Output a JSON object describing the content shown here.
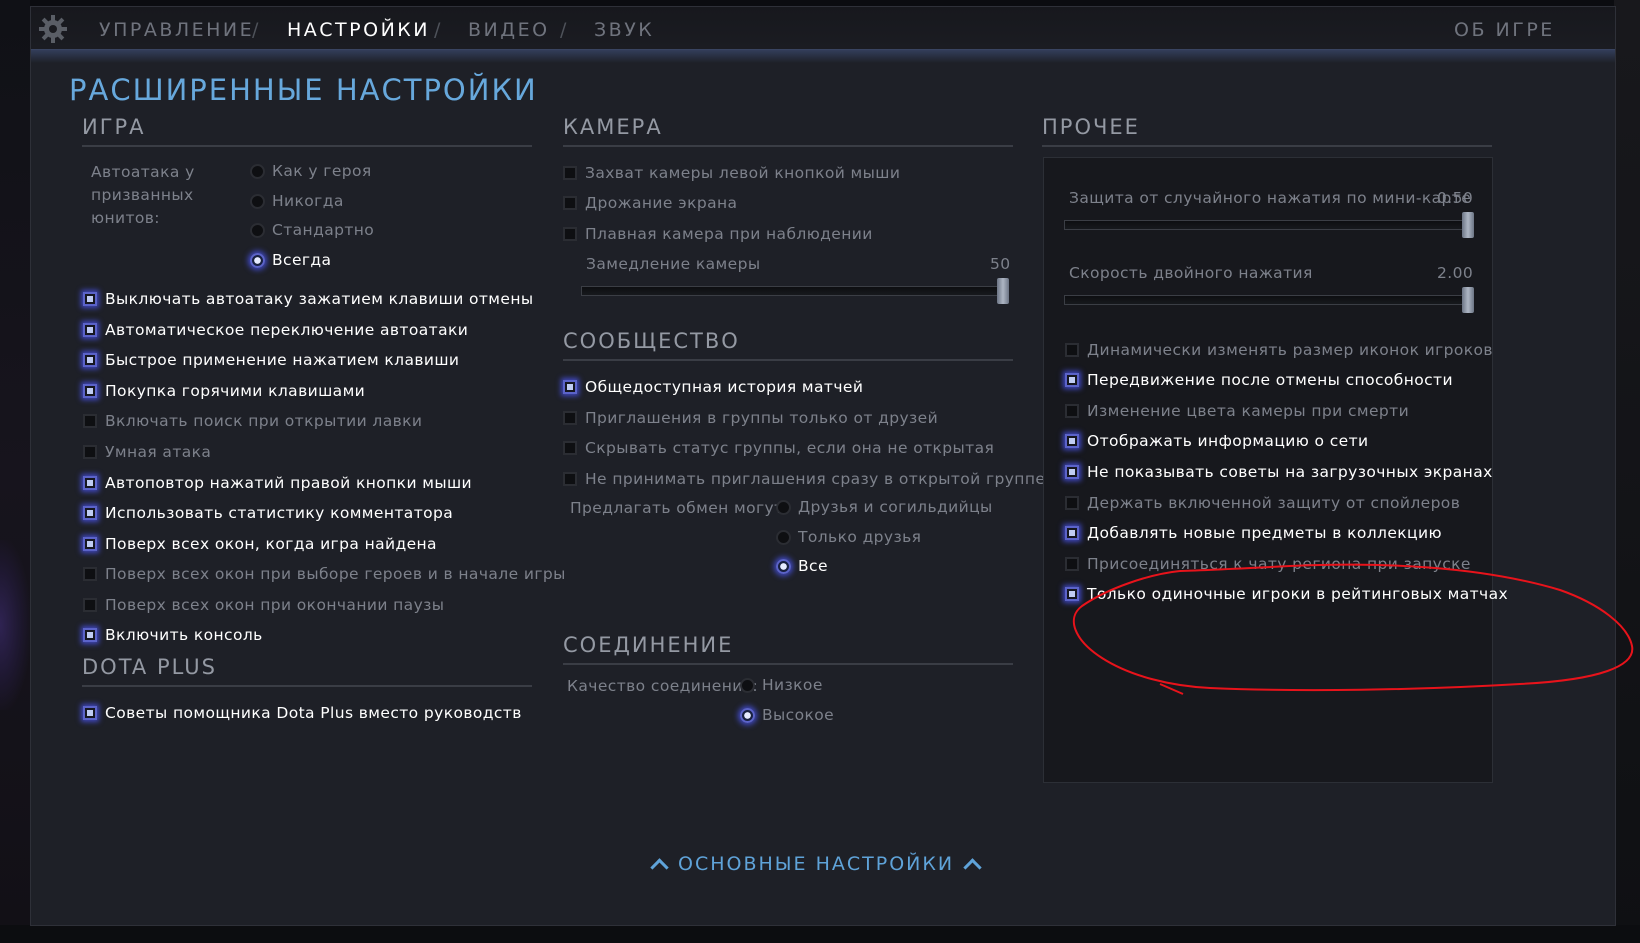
{
  "nav": {
    "tabs": [
      {
        "label": "УПРАВЛЕНИЕ"
      },
      {
        "label": "НАСТРОЙКИ"
      },
      {
        "label": "ВИДЕО"
      },
      {
        "label": "ЗВУК"
      }
    ],
    "separator": "/",
    "about": "ОБ ИГРЕ",
    "active_tab": "НАСТРОЙКИ"
  },
  "page_title": "РАСШИРЕННЫЕ НАСТРОЙКИ",
  "game": {
    "title": "ИГРА",
    "autoattack_label": [
      "Автоатака у",
      "призванных",
      "юнитов:"
    ],
    "autoattack_options": [
      {
        "label": "Как у героя",
        "selected": false
      },
      {
        "label": "Никогда",
        "selected": false
      },
      {
        "label": "Стандартно",
        "selected": false
      },
      {
        "label": "Всегда",
        "selected": true
      }
    ],
    "options": [
      {
        "label": "Выключать автоатаку зажатием клавиши отмены",
        "checked": true
      },
      {
        "label": "Автоматическое переключение автоатаки",
        "checked": true
      },
      {
        "label": "Быстрое применение нажатием клавиши",
        "checked": true
      },
      {
        "label": "Покупка горячими клавишами",
        "checked": true
      },
      {
        "label": "Включать поиск при открытии лавки",
        "checked": false
      },
      {
        "label": "Умная атака",
        "checked": false
      },
      {
        "label": "Автоповтор нажатий правой кнопки мыши",
        "checked": true
      },
      {
        "label": "Использовать статистику комментатора",
        "checked": true
      },
      {
        "label": "Поверх всех окон, когда игра найдена",
        "checked": true
      },
      {
        "label": "Поверх всех окон при выборе героев и в начале игры",
        "checked": false
      },
      {
        "label": "Поверх всех окон при окончании паузы",
        "checked": false
      },
      {
        "label": "Включить консоль",
        "checked": true
      }
    ]
  },
  "dota_plus": {
    "title": "DOTA PLUS",
    "options": [
      {
        "label": "Советы помощника Dota Plus вместо руководств",
        "checked": true
      }
    ]
  },
  "camera": {
    "title": "КАМЕРА",
    "options": [
      {
        "label": "Захват камеры левой кнопкой мыши",
        "checked": false
      },
      {
        "label": "Дрожание экрана",
        "checked": false
      },
      {
        "label": "Плавная камера при наблюдении",
        "checked": false
      }
    ],
    "slowdown_label": "Замедление камеры",
    "slowdown_value": "50",
    "slowdown_fraction": 1.0
  },
  "community": {
    "title": "СООБЩЕСТВО",
    "options": [
      {
        "label": "Общедоступная история матчей",
        "checked": true
      },
      {
        "label": "Приглашения в группы только от друзей",
        "checked": false
      },
      {
        "label": "Скрывать статус группы, если она не открытая",
        "checked": false
      },
      {
        "label": "Не принимать приглашения сразу в открытой группе",
        "checked": false
      }
    ],
    "trade_label": "Предлагать обмен могут:",
    "trade_options": [
      {
        "label": "Друзья и согильдийцы",
        "selected": false
      },
      {
        "label": "Только друзья",
        "selected": false
      },
      {
        "label": "Все",
        "selected": true
      }
    ]
  },
  "connection": {
    "title": "СОЕДИНЕНИЕ",
    "quality_label": "Качество соединения:",
    "quality_options": [
      {
        "label": "Низкое",
        "selected": false
      },
      {
        "label": "Высокое",
        "selected": true
      }
    ]
  },
  "misc": {
    "title": "ПРОЧЕЕ",
    "minimap_protect_label": "Защита от случайного нажатия по мини-карте",
    "minimap_protect_value": "0.50",
    "minimap_protect_fraction": 1.0,
    "double_tap_label": "Скорость двойного нажатия",
    "double_tap_value": "2.00",
    "double_tap_fraction": 1.0,
    "options": [
      {
        "label": "Динамически изменять размер иконок игроков",
        "checked": false
      },
      {
        "label": "Передвижение после отмены способности",
        "checked": true
      },
      {
        "label": "Изменение цвета камеры при смерти",
        "checked": false
      },
      {
        "label": "Отображать информацию о сети",
        "checked": true
      },
      {
        "label": "Не показывать советы на загрузочных экранах",
        "checked": true
      },
      {
        "label": "Держать включенной защиту от спойлеров",
        "checked": false
      },
      {
        "label": "Добавлять новые предметы в коллекцию",
        "checked": true
      },
      {
        "label": "Присоединяться к чату региона при запуске",
        "checked": false
      },
      {
        "label": "Только одиночные игроки в рейтинговых матчах",
        "checked": true
      }
    ]
  },
  "bottom_link": "ОСНОВНЫЕ НАСТРОЙКИ",
  "colors": {
    "accent": "#67a8dc",
    "annotation": "#e8131b",
    "checked_glow": "#5b63c9"
  },
  "icons": {
    "settings": "gear-icon",
    "bottom_link": "chevron-up-icon"
  }
}
